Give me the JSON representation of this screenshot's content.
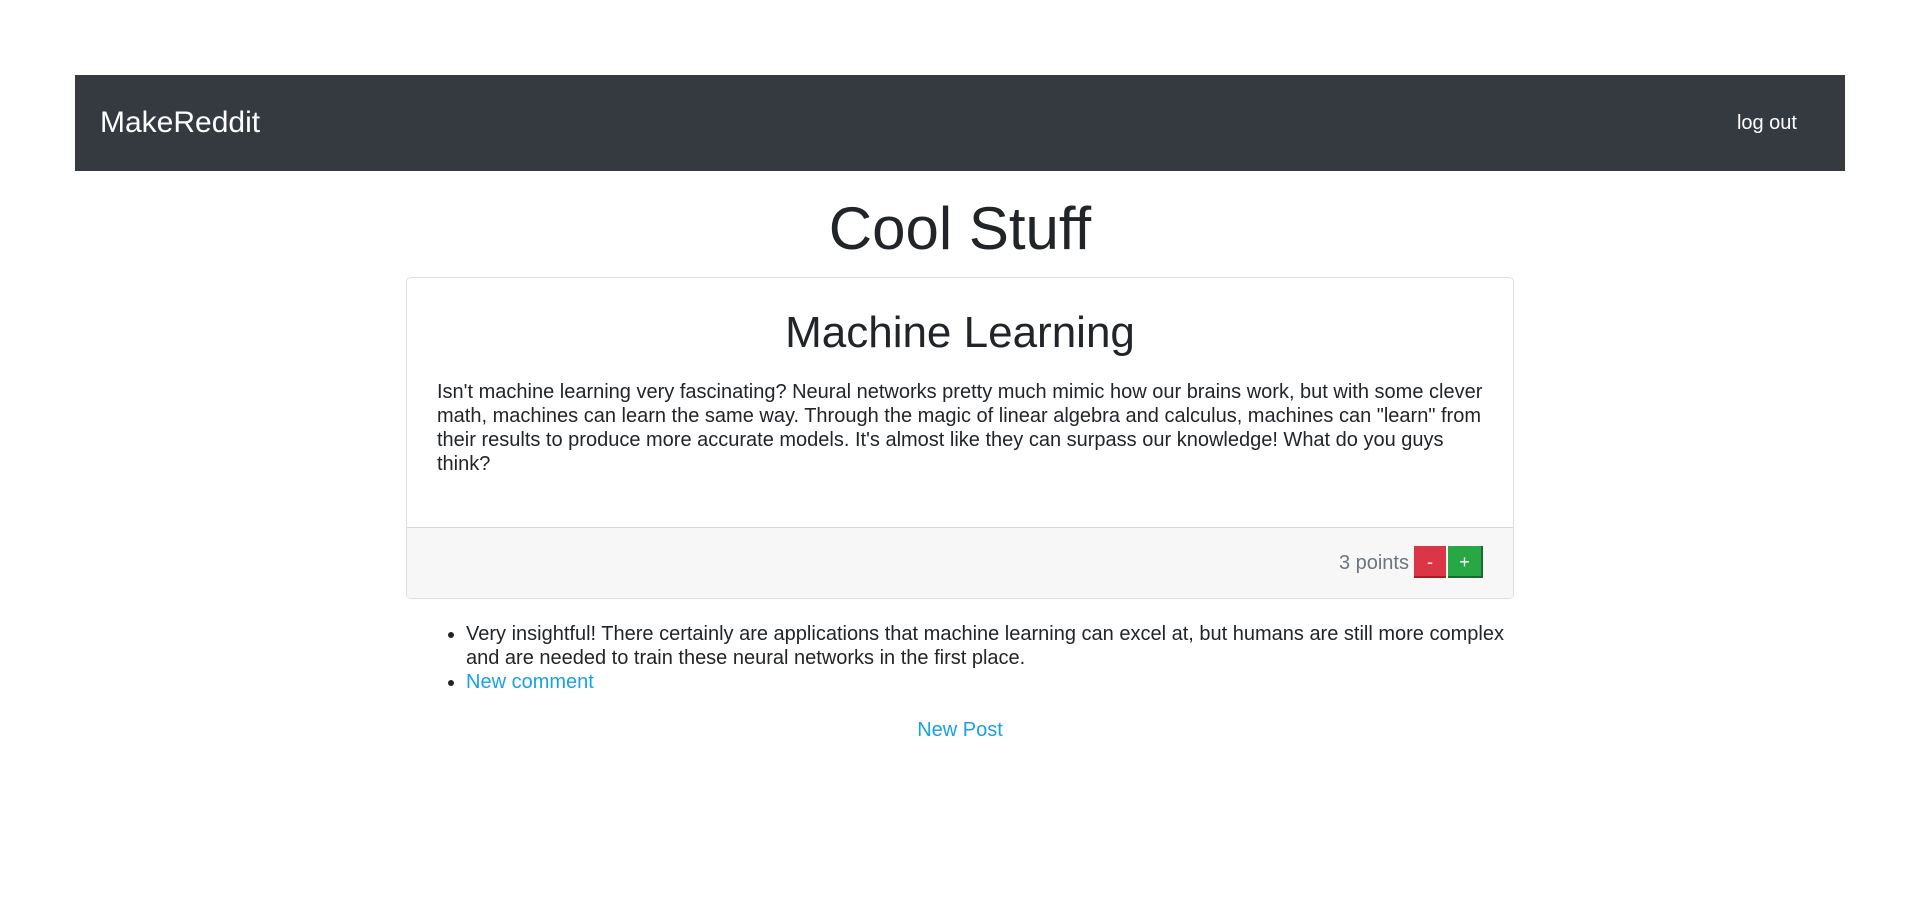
{
  "navbar": {
    "brand": "MakeReddit",
    "logout_label": "log out",
    "background_color": "#343a40"
  },
  "subreddit": {
    "title": "Cool Stuff"
  },
  "post": {
    "title": "Machine Learning",
    "body": "Isn't machine learning very fascinating? Neural networks pretty much mimic how our brains work, but with some clever math, machines can learn the same way. Through the magic of linear algebra and calculus, machines can \"learn\" from their results to produce more accurate models. It's almost like they can surpass our knowledge! What do you guys think?",
    "points_text": "3 points",
    "downvote_label": "-",
    "upvote_label": "+",
    "downvote_color": "#dc3545",
    "upvote_color": "#28a745"
  },
  "comments": {
    "items": [
      {
        "text": "Very insightful! There certainly are applications that machine learning can excel at, but humans are still more complex and are needed to train these neural networks in the first place."
      }
    ],
    "new_comment_label": "New comment"
  },
  "actions": {
    "new_post_label": "New Post",
    "link_color": "#17a2e6"
  }
}
